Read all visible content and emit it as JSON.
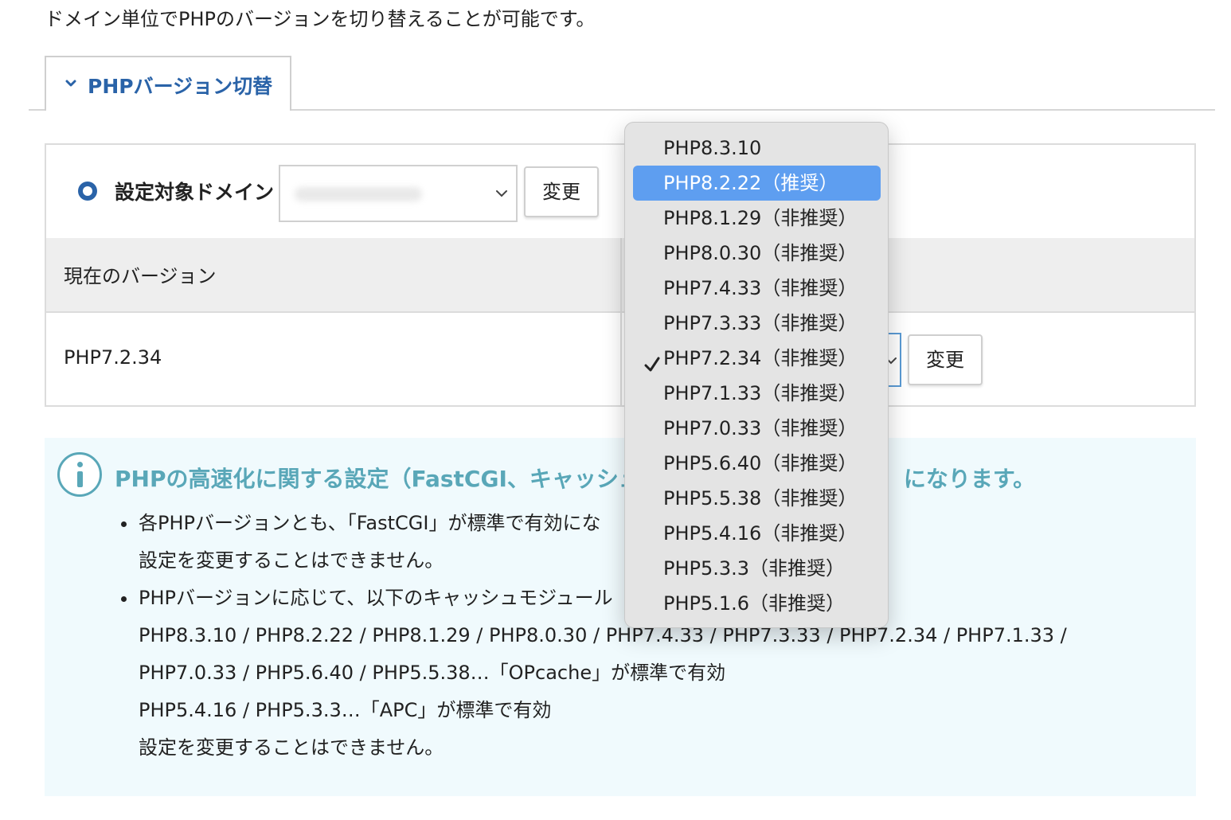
{
  "intro": "ドメイン単位でPHPのバージョンを切り替えることが可能です。",
  "tab": {
    "label": "PHPバージョン切替"
  },
  "setting": {
    "domain_label": "設定対象ドメイン",
    "domain_change_button": "変更",
    "current_version_header": "現在のバージョン",
    "current_version": "PHP7.2.34",
    "php_change_button": "変更"
  },
  "info": {
    "title": "PHPの高速化に関する設定（FastCGI、キャッシュ",
    "title_tail": "になります。",
    "items": [
      {
        "line1": "各PHPバージョンとも、「FastCGI」が標準で有効にな",
        "line2": "設定を変更することはできません。"
      },
      {
        "line1": "PHPバージョンに応じて、以下のキャッシュモジュール",
        "line2": "PHP8.3.10 / PHP8.2.22 / PHP8.1.29 / PHP8.0.30 / PHP7.4.33 / PHP7.3.33 / PHP7.2.34 / PHP7.1.33 /",
        "line3": "PHP7.0.33 / PHP5.6.40 / PHP5.5.38…「OPcache」が標準で有効",
        "line4": "PHP5.4.16 / PHP5.3.3…「APC」が標準で有効",
        "line5": "設定を変更することはできません。"
      }
    ]
  },
  "dropdown": {
    "options": [
      "PHP8.3.10",
      "PHP8.2.22（推奨）",
      "PHP8.1.29（非推奨）",
      "PHP8.0.30（非推奨）",
      "PHP7.4.33（非推奨）",
      "PHP7.3.33（非推奨）",
      "PHP7.2.34（非推奨）",
      "PHP7.1.33（非推奨）",
      "PHP7.0.33（非推奨）",
      "PHP5.6.40（非推奨）",
      "PHP5.5.38（非推奨）",
      "PHP5.4.16（非推奨）",
      "PHP5.3.3（非推奨）",
      "PHP5.1.6（非推奨）"
    ],
    "highlighted": "PHP8.2.22（推奨）",
    "checked": "PHP7.2.34（非推奨）"
  },
  "colors": {
    "accent": "#2a63a8",
    "info_title": "#59a7b8",
    "highlight": "#5e9ef0",
    "info_bg": "#f0fafd",
    "header_bg": "#eeeeee"
  },
  "icons": [
    "chevron-down-icon",
    "radio-icon",
    "info-icon",
    "checkmark-icon"
  ]
}
